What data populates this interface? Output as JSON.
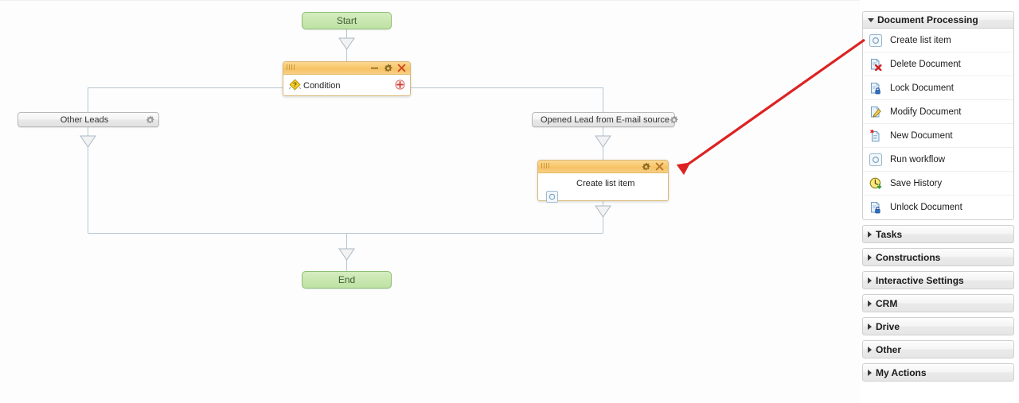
{
  "canvas": {
    "start_node": {
      "label": "Start"
    },
    "end_node": {
      "label": "End"
    },
    "condition_node": {
      "title": "Condition",
      "icon": "condition-diamond-icon",
      "minimize_title": "Minimize",
      "settings_title": "Settings",
      "close_title": "Close",
      "add_title": "Add"
    },
    "branches": [
      {
        "label": "Other Leads",
        "gear": "gear-icon"
      },
      {
        "label": "Opened Lead from E-mail source",
        "gear": "gear-icon"
      }
    ],
    "activity_node": {
      "title": "Create list item",
      "icon": "create-list-item-icon",
      "settings_title": "Settings",
      "close_title": "Close"
    },
    "annotation": {
      "color": "#dd2222",
      "type": "arrow"
    }
  },
  "sidebar": {
    "groups": [
      {
        "title": "Document Processing",
        "expanded": true,
        "items": [
          {
            "label": "Create list item",
            "icon": "create-list-item-icon"
          },
          {
            "label": "Delete Document",
            "icon": "delete-document-icon"
          },
          {
            "label": "Lock Document",
            "icon": "lock-document-icon"
          },
          {
            "label": "Modify Document",
            "icon": "modify-document-icon"
          },
          {
            "label": "New Document",
            "icon": "new-document-icon"
          },
          {
            "label": "Run workflow",
            "icon": "run-workflow-icon"
          },
          {
            "label": "Save History",
            "icon": "save-history-icon"
          },
          {
            "label": "Unlock Document",
            "icon": "unlock-document-icon"
          }
        ]
      },
      {
        "title": "Tasks",
        "expanded": false,
        "items": []
      },
      {
        "title": "Constructions",
        "expanded": false,
        "items": []
      },
      {
        "title": "Interactive Settings",
        "expanded": false,
        "items": []
      },
      {
        "title": "CRM",
        "expanded": false,
        "items": []
      },
      {
        "title": "Drive",
        "expanded": false,
        "items": []
      },
      {
        "title": "Other",
        "expanded": false,
        "items": []
      },
      {
        "title": "My Actions",
        "expanded": false,
        "items": []
      }
    ]
  }
}
